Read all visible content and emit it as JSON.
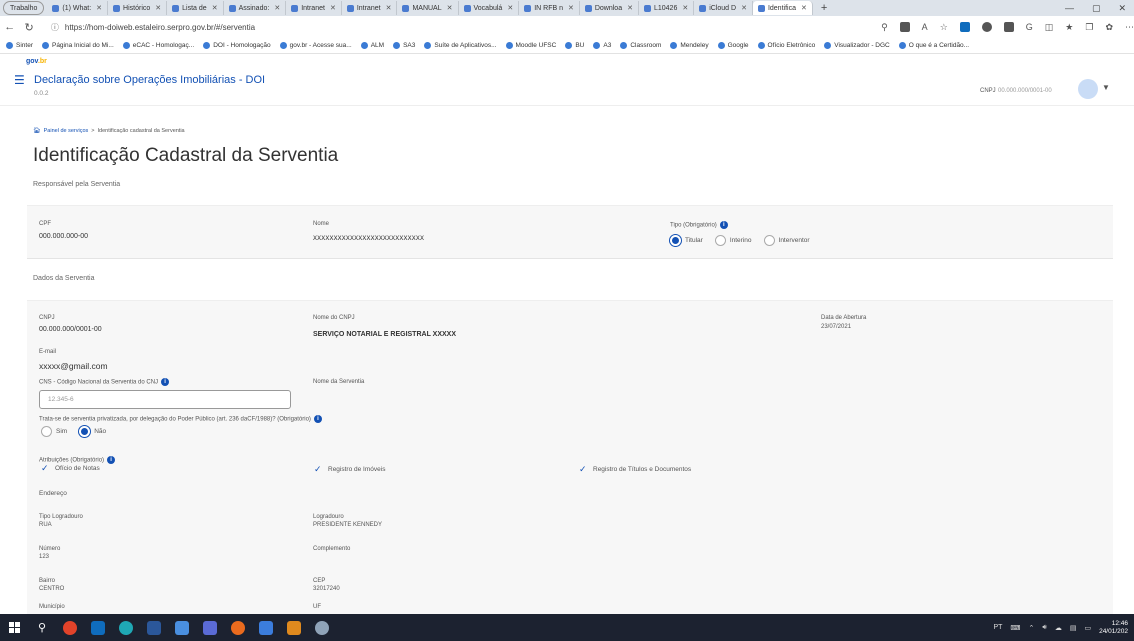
{
  "browser": {
    "tabs": [
      {
        "label": "Trabalho",
        "profile": true
      },
      {
        "label": "(1) What:"
      },
      {
        "label": "Histórico"
      },
      {
        "label": "Lista de"
      },
      {
        "label": "Assinado:"
      },
      {
        "label": "Intranet"
      },
      {
        "label": "Intranet"
      },
      {
        "label": "MANUAL"
      },
      {
        "label": "Vocabulá"
      },
      {
        "label": "IN RFB n"
      },
      {
        "label": "Downloa"
      },
      {
        "label": "L10426"
      },
      {
        "label": "iCloud D"
      },
      {
        "label": "Identifica",
        "active": true
      }
    ],
    "url": "https://hom-doiweb.estaleiro.serpro.gov.br/#/serventia",
    "bookmarks": [
      "Sinter",
      "Página Inicial do Mi...",
      "eCAC - Homologaç...",
      "DOI - Homologação",
      "gov.br - Acesse sua...",
      "ALM",
      "SA3",
      "Suíte de Aplicativos...",
      "Moodle UFSC",
      "BU",
      "A3",
      "Classroom",
      "Mendeley",
      "Google",
      "Ofício Eletrônico",
      "Visualizador - DGC",
      "O que é a Certidão..."
    ]
  },
  "header": {
    "logo_part1": "gov",
    "logo_part2": ".br",
    "title": "Declaração sobre Operações Imobiliárias - DOI",
    "version": "0.0.2",
    "cnpj_label": "CNPJ",
    "cnpj_value": "00.000.000/0001-00"
  },
  "breadcrumb": {
    "home": "Painel de serviços",
    "separator": ">",
    "current": "Identificação cadastral da Serventia"
  },
  "page_title": "Identificação Cadastral da Serventia",
  "responsavel": {
    "section_title": "Responsável pela Serventia",
    "cpf_label": "CPF",
    "cpf_value": "000.000.000-00",
    "nome_label": "Nome",
    "nome_value": "XXXXXXXXXXXXXXXXXXXXXXXXXXX",
    "tipo_label": "Tipo (Obrigatório)",
    "tipo_options": [
      "Titular",
      "Interino",
      "Interventor"
    ],
    "tipo_selected": "Titular"
  },
  "dados": {
    "section_title": "Dados da Serventia",
    "cnpj_label": "CNPJ",
    "cnpj_value": "00.000.000/0001-00",
    "nome_cnpj_label": "Nome do CNPJ",
    "nome_cnpj_value": "SERVIÇO NOTARIAL E REGISTRAL XXXXX",
    "data_abertura_label": "Data de Abertura",
    "data_abertura_value": "23/07/2021",
    "email_label": "E-mail",
    "email_value": "xxxxx@gmail.com",
    "cns_label": "CNS - Código Nacional da Serventia do CNJ",
    "cns_placeholder": "12.345-6",
    "nome_serventia_label": "Nome da Serventia",
    "privatizada_label": "Trata-se de serventia privatizada, por delegação do Poder Público (art. 236 daCF/1988)? (Obrigatório)",
    "privatizada_options": [
      "Sim",
      "Não"
    ],
    "privatizada_selected": "Não",
    "atribuicoes_label": "Atribuições (Obrigatório)",
    "atribuicoes": [
      "Ofício de Notas",
      "Registro de Imóveis",
      "Registro de Títulos e Documentos"
    ],
    "endereco_title": "Endereço",
    "tipo_logradouro_label": "Tipo Logradouro",
    "tipo_logradouro_value": "RUA",
    "logradouro_label": "Logradouro",
    "logradouro_value": "PRESIDENTE KENNEDY",
    "numero_label": "Número",
    "numero_value": "123",
    "complemento_label": "Complemento",
    "bairro_label": "Bairro",
    "bairro_value": "CENTRO",
    "cep_label": "CEP",
    "cep_value": "32017240",
    "municipio_label": "Município",
    "uf_label": "UF"
  },
  "taskbar": {
    "lang": "PT",
    "time": "12:46",
    "date": "24/01/202"
  },
  "colors": {
    "primary": "#1351b4",
    "panel_bg": "#f7f7f7",
    "taskbar_bg": "#1c2230"
  }
}
